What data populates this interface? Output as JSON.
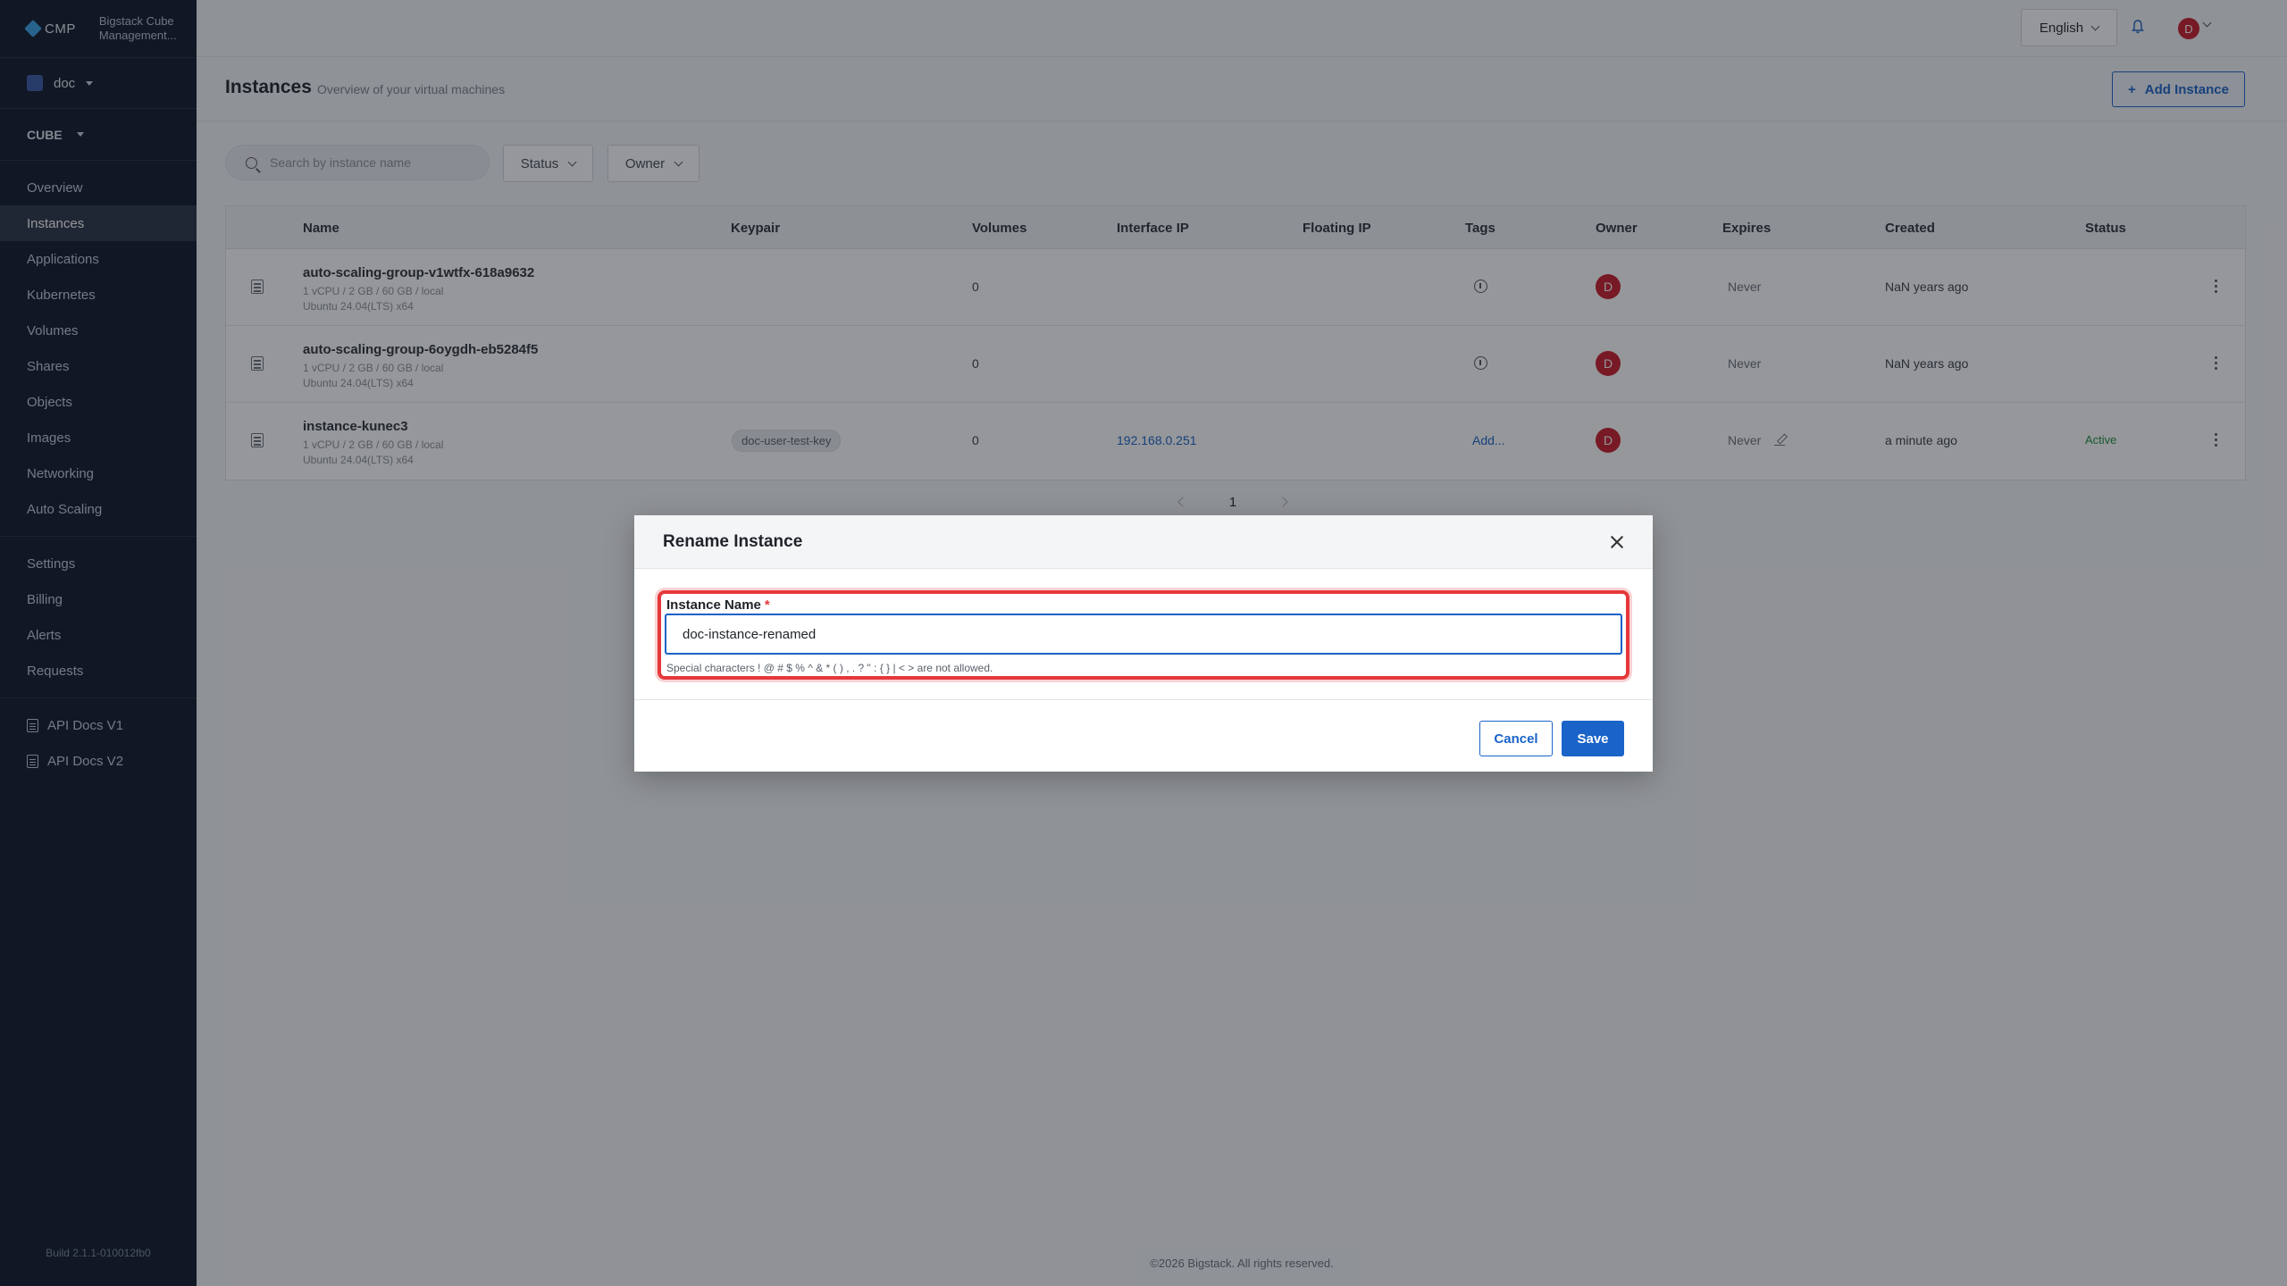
{
  "brand": {
    "logo": "CMP",
    "subtitle_line1": "Bigstack Cube",
    "subtitle_line2": "Management..."
  },
  "project": {
    "name": "doc"
  },
  "region": {
    "name": "CUBE"
  },
  "sidebar": {
    "main": [
      "Overview",
      "Instances",
      "Applications",
      "Kubernetes",
      "Volumes",
      "Shares",
      "Objects",
      "Images",
      "Networking",
      "Auto Scaling"
    ],
    "account": [
      "Settings",
      "Billing",
      "Alerts",
      "Requests"
    ],
    "docs": [
      "API Docs V1",
      "API Docs V2"
    ],
    "build": "Build 2.1.1-010012fb0"
  },
  "topbar": {
    "language": "English",
    "avatar_letter": "D"
  },
  "page": {
    "title": "Instances",
    "subtitle": "Overview of your virtual machines",
    "add_button": "Add Instance"
  },
  "filters": {
    "search_placeholder": "Search by instance name",
    "status": "Status",
    "owner": "Owner"
  },
  "table": {
    "headers": {
      "name": "Name",
      "keypair": "Keypair",
      "volumes": "Volumes",
      "interface_ip": "Interface IP",
      "floating_ip": "Floating IP",
      "tags": "Tags",
      "owner": "Owner",
      "expires": "Expires",
      "created": "Created",
      "status": "Status"
    },
    "rows": [
      {
        "name": "auto-scaling-group-v1wtfx-618a9632",
        "spec": "1 vCPU / 2 GB / 60 GB / local",
        "os": "Ubuntu 24.04(LTS) x64",
        "keypair": "",
        "volumes": "0",
        "interface_ip": "",
        "floating_ip": "",
        "tags": "",
        "owner": "D",
        "expires": "Never",
        "created": "NaN years ago",
        "status": ""
      },
      {
        "name": "auto-scaling-group-6oygdh-eb5284f5",
        "spec": "1 vCPU / 2 GB / 60 GB / local",
        "os": "Ubuntu 24.04(LTS) x64",
        "keypair": "",
        "volumes": "0",
        "interface_ip": "",
        "floating_ip": "",
        "tags": "",
        "owner": "D",
        "expires": "Never",
        "created": "NaN years ago",
        "status": ""
      },
      {
        "name": "instance-kunec3",
        "spec": "1 vCPU / 2 GB / 60 GB / local",
        "os": "Ubuntu 24.04(LTS) x64",
        "keypair": "doc-user-test-key",
        "volumes": "0",
        "interface_ip": "192.168.0.251",
        "floating_ip": "",
        "tags": "Add...",
        "owner": "D",
        "expires": "Never",
        "created": "a minute ago",
        "status": "Active"
      }
    ]
  },
  "pagination": {
    "current": "1"
  },
  "footer": "©2026 Bigstack. All rights reserved.",
  "modal": {
    "title": "Rename Instance",
    "field_label": "Instance Name",
    "required_mark": "*",
    "value": "doc-instance-renamed",
    "hint": "Special characters ! @ # $ % ^ & * ( ) , . ? \" : { } | < > are not allowed.",
    "cancel": "Cancel",
    "save": "Save"
  },
  "colors": {
    "sidebar_bg": "#0f1729",
    "accent": "#1a63c9",
    "danger": "#e5383b",
    "active_status": "#1f8a3c",
    "avatar": "#c91c2b"
  }
}
